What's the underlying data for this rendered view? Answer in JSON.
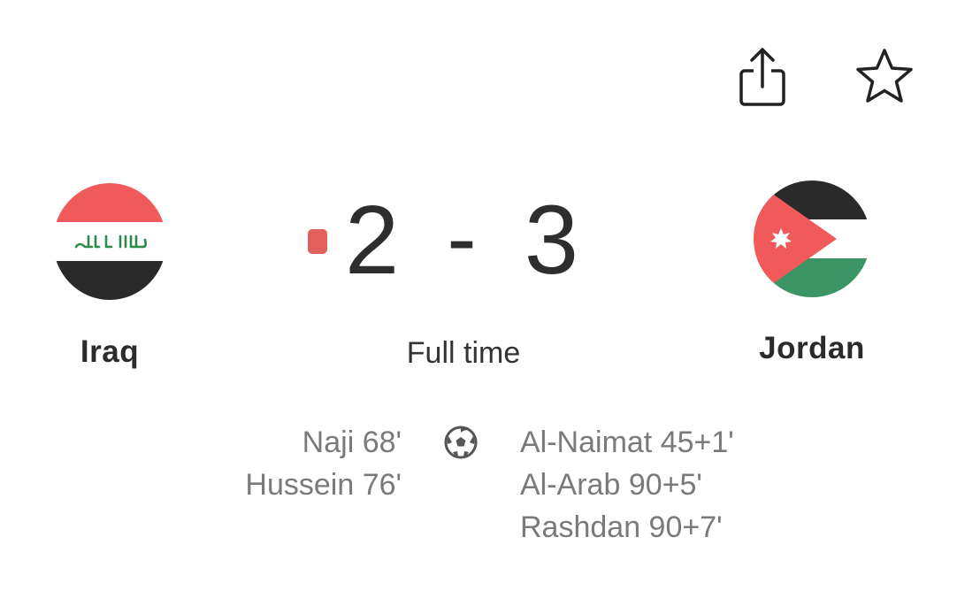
{
  "header": {
    "share_icon": "share-icon",
    "favorite_icon": "star-outline-icon"
  },
  "match": {
    "home_team": {
      "name": "Iraq",
      "flag_icon": "iraq-flag-icon",
      "score": "2",
      "scorers": [
        "Naji 68'",
        "Hussein 76'"
      ]
    },
    "away_team": {
      "name": "Jordan",
      "flag_icon": "jordan-flag-icon",
      "score": "3",
      "scorers": [
        "Al-Naimat 45+1'",
        "Al-Arab 90+5'",
        "Rashdan 90+7'"
      ]
    },
    "separator": "-",
    "status": "Full time",
    "goal_icon": "soccer-ball-icon"
  },
  "colors": {
    "live_indicator": "#e0605c",
    "iraq_red": "#f05a5a",
    "iraq_black": "#2a2a2a",
    "iraq_green": "#2f8a4a",
    "jordan_black": "#2a2a2a",
    "jordan_green": "#3a9463",
    "jordan_red": "#f05a5a",
    "scorer_text": "#7a7a7a"
  }
}
